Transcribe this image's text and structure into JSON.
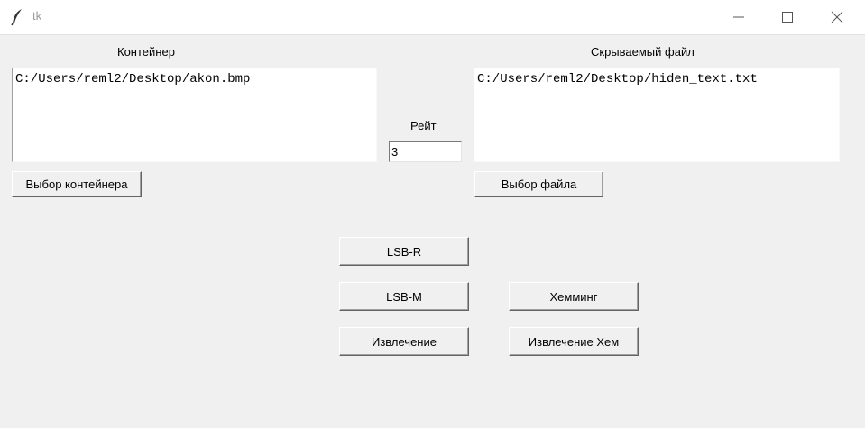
{
  "window": {
    "title": "tk",
    "icon": "feather-icon",
    "controls": [
      "minimize-icon",
      "maximize-icon",
      "close-icon"
    ]
  },
  "container": {
    "label": "Контейнер",
    "path": "C:/Users/reml2/Desktop/akon.bmp",
    "button_label": "Выбор контейнера"
  },
  "hidden_file": {
    "label": "Скрываемый файл",
    "path": "C:/Users/reml2/Desktop/hiden_text.txt",
    "button_label": "Выбор файла"
  },
  "rate": {
    "label": "Рейт",
    "value": "3"
  },
  "actions": {
    "lsb_r": "LSB-R",
    "lsb_m": "LSB-M",
    "extract": "Извлечение",
    "hamming": "Хемминг",
    "extract_hamming": "Извлечение Хем"
  }
}
